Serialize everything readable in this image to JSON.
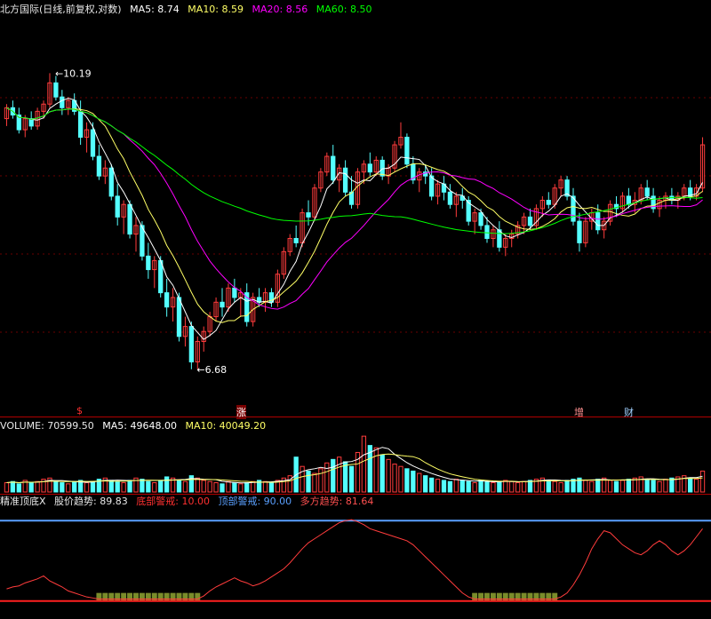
{
  "header": {
    "title": "北方国际(日线,前复权,对数)",
    "ma5": "MA5: 8.74",
    "ma10": "MA10: 8.59",
    "ma20": "MA20: 8.56",
    "ma60": "MA60: 8.50"
  },
  "price_annotations": {
    "high": "10.19",
    "low": "6.68"
  },
  "badges": {
    "s": "$",
    "zhang": "涨",
    "zeng": "增",
    "cai": "财"
  },
  "volume_header": {
    "volume": "VOLUME: 70599.50",
    "ma5": "MA5: 49648.00",
    "ma10": "MA10: 40049.20"
  },
  "indicator_header": {
    "name": "精准顶底X",
    "trend": "股价趋势: 89.83",
    "bottom": "底部警戒: 10.00",
    "top": "顶部警戒: 90.00",
    "bull": "多方趋势: 81.64"
  },
  "colors": {
    "up": "#ff3c3c",
    "down": "#54ffff",
    "ma5": "#ffffff",
    "ma10": "#ffff66",
    "ma20": "#ff00ff",
    "ma60": "#00ff00",
    "bottom_line": "#ff2020",
    "top_line": "#5aa0ff",
    "trend_line": "#ff3c3c",
    "bar_zone": "#7a8c2a"
  },
  "chart_data": [
    {
      "type": "candlestick",
      "title": "北方国际(日线,前复权,对数)",
      "log_scale": true,
      "ylim": [
        6.3,
        11.0
      ],
      "series_names": [
        "MA5",
        "MA10",
        "MA20",
        "MA60"
      ],
      "candles": [
        [
          9.55,
          9.75,
          9.45,
          9.7
        ],
        [
          9.7,
          9.8,
          9.55,
          9.6
        ],
        [
          9.6,
          9.7,
          9.35,
          9.4
        ],
        [
          9.4,
          9.6,
          9.3,
          9.55
        ],
        [
          9.55,
          9.65,
          9.4,
          9.45
        ],
        [
          9.45,
          9.7,
          9.4,
          9.65
        ],
        [
          9.65,
          9.8,
          9.55,
          9.75
        ],
        [
          9.75,
          10.19,
          9.7,
          10.05
        ],
        [
          10.05,
          10.15,
          9.8,
          9.85
        ],
        [
          9.85,
          9.95,
          9.6,
          9.7
        ],
        [
          9.7,
          9.85,
          9.6,
          9.8
        ],
        [
          9.8,
          9.9,
          9.6,
          9.65
        ],
        [
          9.65,
          9.8,
          9.2,
          9.3
        ],
        [
          9.3,
          9.5,
          9.1,
          9.4
        ],
        [
          9.4,
          9.5,
          9.0,
          9.05
        ],
        [
          9.05,
          9.2,
          8.75,
          8.8
        ],
        [
          8.8,
          9.0,
          8.7,
          8.9
        ],
        [
          8.9,
          8.95,
          8.5,
          8.55
        ],
        [
          8.55,
          8.7,
          8.2,
          8.3
        ],
        [
          8.3,
          8.5,
          8.1,
          8.45
        ],
        [
          8.45,
          8.5,
          8.05,
          8.1
        ],
        [
          8.1,
          8.3,
          7.9,
          8.2
        ],
        [
          8.2,
          8.25,
          7.8,
          7.85
        ],
        [
          7.85,
          8.0,
          7.6,
          7.7
        ],
        [
          7.7,
          7.85,
          7.5,
          7.8
        ],
        [
          7.8,
          7.85,
          7.4,
          7.45
        ],
        [
          7.45,
          7.6,
          7.2,
          7.3
        ],
        [
          7.3,
          7.5,
          7.15,
          7.4
        ],
        [
          7.4,
          7.45,
          6.95,
          7.0
        ],
        [
          7.0,
          7.2,
          6.9,
          7.1
        ],
        [
          7.1,
          7.15,
          6.68,
          6.75
        ],
        [
          6.75,
          7.0,
          6.68,
          6.95
        ],
        [
          6.95,
          7.1,
          6.85,
          7.05
        ],
        [
          7.05,
          7.25,
          7.0,
          7.2
        ],
        [
          7.2,
          7.4,
          7.15,
          7.35
        ],
        [
          7.35,
          7.5,
          7.2,
          7.3
        ],
        [
          7.3,
          7.55,
          7.25,
          7.5
        ],
        [
          7.5,
          7.6,
          7.35,
          7.4
        ],
        [
          7.4,
          7.5,
          7.2,
          7.45
        ],
        [
          7.45,
          7.55,
          7.1,
          7.15
        ],
        [
          7.15,
          7.45,
          7.1,
          7.4
        ],
        [
          7.4,
          7.5,
          7.3,
          7.35
        ],
        [
          7.35,
          7.5,
          7.25,
          7.45
        ],
        [
          7.45,
          7.5,
          7.3,
          7.35
        ],
        [
          7.35,
          7.7,
          7.3,
          7.65
        ],
        [
          7.65,
          7.95,
          7.6,
          7.9
        ],
        [
          7.9,
          8.1,
          7.85,
          8.05
        ],
        [
          8.05,
          8.2,
          7.95,
          8.0
        ],
        [
          8.0,
          8.4,
          7.95,
          8.35
        ],
        [
          8.35,
          8.5,
          8.2,
          8.3
        ],
        [
          8.3,
          8.7,
          8.25,
          8.65
        ],
        [
          8.65,
          8.9,
          8.6,
          8.85
        ],
        [
          8.85,
          9.1,
          8.8,
          9.05
        ],
        [
          9.05,
          9.2,
          8.7,
          8.75
        ],
        [
          8.75,
          8.95,
          8.6,
          8.9
        ],
        [
          8.9,
          9.0,
          8.55,
          8.6
        ],
        [
          8.6,
          8.8,
          8.4,
          8.45
        ],
        [
          8.45,
          8.9,
          8.4,
          8.85
        ],
        [
          8.85,
          9.0,
          8.7,
          8.95
        ],
        [
          8.95,
          9.1,
          8.8,
          8.85
        ],
        [
          8.85,
          9.05,
          8.8,
          9.0
        ],
        [
          9.0,
          9.05,
          8.75,
          8.8
        ],
        [
          8.8,
          8.95,
          8.7,
          8.9
        ],
        [
          8.9,
          9.25,
          8.85,
          9.2
        ],
        [
          9.2,
          9.5,
          9.15,
          9.3
        ],
        [
          9.3,
          9.35,
          8.9,
          8.95
        ],
        [
          8.95,
          9.05,
          8.7,
          8.75
        ],
        [
          8.75,
          8.9,
          8.6,
          8.85
        ],
        [
          8.85,
          8.95,
          8.7,
          8.8
        ],
        [
          8.8,
          8.9,
          8.5,
          8.55
        ],
        [
          8.55,
          8.75,
          8.45,
          8.7
        ],
        [
          8.7,
          8.8,
          8.5,
          8.6
        ],
        [
          8.6,
          8.7,
          8.4,
          8.45
        ],
        [
          8.45,
          8.6,
          8.3,
          8.55
        ],
        [
          8.55,
          8.65,
          8.4,
          8.5
        ],
        [
          8.5,
          8.55,
          8.2,
          8.25
        ],
        [
          8.25,
          8.4,
          8.1,
          8.35
        ],
        [
          8.35,
          8.4,
          8.15,
          8.2
        ],
        [
          8.2,
          8.3,
          8.0,
          8.05
        ],
        [
          8.05,
          8.2,
          7.95,
          8.15
        ],
        [
          8.15,
          8.25,
          7.9,
          7.95
        ],
        [
          7.95,
          8.1,
          7.85,
          8.05
        ],
        [
          8.05,
          8.15,
          7.95,
          8.1
        ],
        [
          8.1,
          8.25,
          8.05,
          8.2
        ],
        [
          8.2,
          8.35,
          8.1,
          8.3
        ],
        [
          8.3,
          8.4,
          8.15,
          8.2
        ],
        [
          8.2,
          8.45,
          8.15,
          8.4
        ],
        [
          8.4,
          8.55,
          8.3,
          8.5
        ],
        [
          8.5,
          8.6,
          8.4,
          8.45
        ],
        [
          8.45,
          8.7,
          8.4,
          8.65
        ],
        [
          8.65,
          8.8,
          8.55,
          8.75
        ],
        [
          8.75,
          8.8,
          8.5,
          8.55
        ],
        [
          8.55,
          8.65,
          8.2,
          8.25
        ],
        [
          8.25,
          8.35,
          7.9,
          8.0
        ],
        [
          8.0,
          8.3,
          7.95,
          8.25
        ],
        [
          8.25,
          8.4,
          8.15,
          8.35
        ],
        [
          8.35,
          8.45,
          8.1,
          8.15
        ],
        [
          8.15,
          8.3,
          8.05,
          8.25
        ],
        [
          8.25,
          8.5,
          8.2,
          8.45
        ],
        [
          8.45,
          8.55,
          8.3,
          8.4
        ],
        [
          8.4,
          8.6,
          8.35,
          8.55
        ],
        [
          8.55,
          8.65,
          8.4,
          8.45
        ],
        [
          8.45,
          8.6,
          8.35,
          8.5
        ],
        [
          8.5,
          8.7,
          8.45,
          8.65
        ],
        [
          8.65,
          8.75,
          8.5,
          8.55
        ],
        [
          8.55,
          8.65,
          8.35,
          8.4
        ],
        [
          8.4,
          8.55,
          8.3,
          8.5
        ],
        [
          8.5,
          8.6,
          8.4,
          8.55
        ],
        [
          8.55,
          8.65,
          8.45,
          8.5
        ],
        [
          8.5,
          8.6,
          8.4,
          8.55
        ],
        [
          8.55,
          8.7,
          8.5,
          8.65
        ],
        [
          8.65,
          8.75,
          8.5,
          8.55
        ],
        [
          8.55,
          8.7,
          8.5,
          8.65
        ],
        [
          8.65,
          9.3,
          8.6,
          9.2
        ]
      ]
    },
    {
      "type": "bar",
      "title": "VOLUME",
      "series_names": [
        "VOLUME",
        "MA5",
        "MA10"
      ],
      "values": [
        8,
        9,
        7,
        10,
        8,
        9,
        11,
        12,
        9,
        8,
        7,
        9,
        10,
        8,
        9,
        11,
        12,
        10,
        9,
        8,
        10,
        12,
        11,
        9,
        8,
        10,
        13,
        12,
        10,
        9,
        14,
        12,
        10,
        9,
        8,
        7,
        9,
        8,
        7,
        8,
        9,
        10,
        9,
        8,
        10,
        12,
        14,
        30,
        22,
        18,
        16,
        20,
        25,
        28,
        30,
        26,
        22,
        34,
        48,
        40,
        38,
        32,
        28,
        24,
        22,
        20,
        18,
        16,
        14,
        12,
        11,
        10,
        9,
        11,
        10,
        9,
        8,
        10,
        9,
        8,
        9,
        10,
        9,
        8,
        9,
        10,
        11,
        12,
        10,
        9,
        8,
        10,
        11,
        12,
        10,
        9,
        11,
        12,
        10,
        9,
        10,
        11,
        12,
        13,
        11,
        10,
        9,
        11,
        12,
        13,
        14,
        12,
        11,
        18
      ]
    },
    {
      "type": "line",
      "title": "精准顶底X",
      "ylim": [
        0,
        100
      ],
      "bottom_warning": 10,
      "top_warning": 90,
      "trend": [
        22,
        24,
        25,
        28,
        30,
        32,
        35,
        30,
        27,
        24,
        20,
        18,
        16,
        14,
        13,
        12,
        12,
        12,
        12,
        12,
        12,
        12,
        12,
        12,
        12,
        12,
        12,
        12,
        12,
        12,
        12,
        12,
        15,
        20,
        24,
        27,
        30,
        33,
        30,
        28,
        25,
        27,
        30,
        34,
        38,
        42,
        48,
        55,
        62,
        68,
        72,
        76,
        80,
        84,
        88,
        90,
        91,
        89,
        86,
        82,
        80,
        78,
        76,
        74,
        72,
        70,
        66,
        60,
        54,
        48,
        42,
        36,
        30,
        24,
        18,
        14,
        12,
        12,
        12,
        12,
        12,
        12,
        12,
        12,
        12,
        12,
        12,
        12,
        12,
        12,
        14,
        18,
        26,
        36,
        48,
        62,
        72,
        80,
        78,
        72,
        66,
        62,
        58,
        56,
        60,
        66,
        70,
        66,
        60,
        56,
        60,
        66,
        74,
        82
      ]
    }
  ]
}
